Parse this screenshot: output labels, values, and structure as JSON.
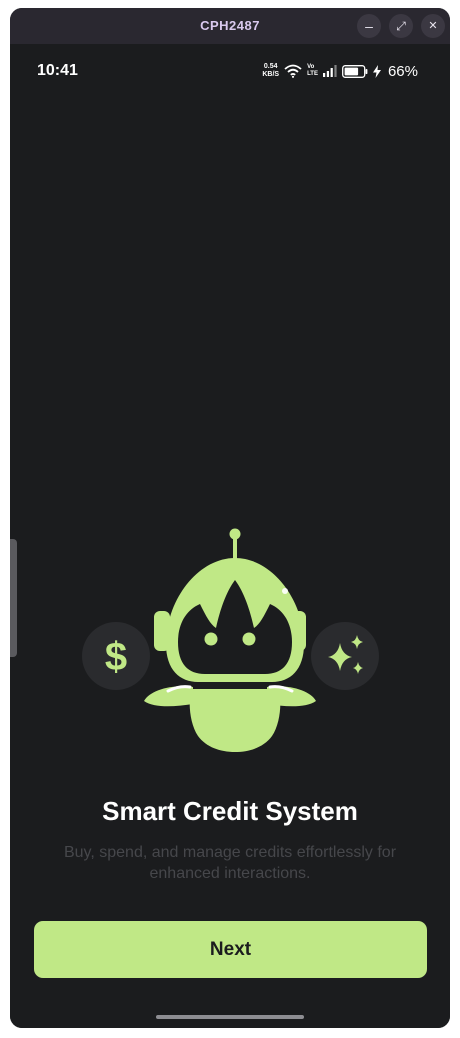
{
  "window": {
    "title": "CPH2487",
    "minimize_label": "–",
    "maximize_label": "⤢",
    "close_label": "✕"
  },
  "status_bar": {
    "time": "10:41",
    "net_speed_value": "0.54",
    "net_speed_unit": "KB/S",
    "volte_top": "Vo",
    "volte_bottom": "LTE",
    "battery_percent": "66%",
    "icons": [
      "wifi-icon",
      "volte-icon",
      "signal-icon",
      "battery-icon",
      "charging-bolt-icon"
    ]
  },
  "onboarding": {
    "title": "Smart Credit System",
    "description": "Buy, spend, and manage credits effortlessly for enhanced interactions.",
    "next_label": "Next",
    "illustration_icons": [
      "robot-mascot-icon",
      "dollar-icon",
      "sparkles-icon"
    ]
  },
  "colors": {
    "accent": "#c0e886",
    "background": "#1b1c1e",
    "titlebar": "#2a2830",
    "muted_text": "#46474b"
  }
}
